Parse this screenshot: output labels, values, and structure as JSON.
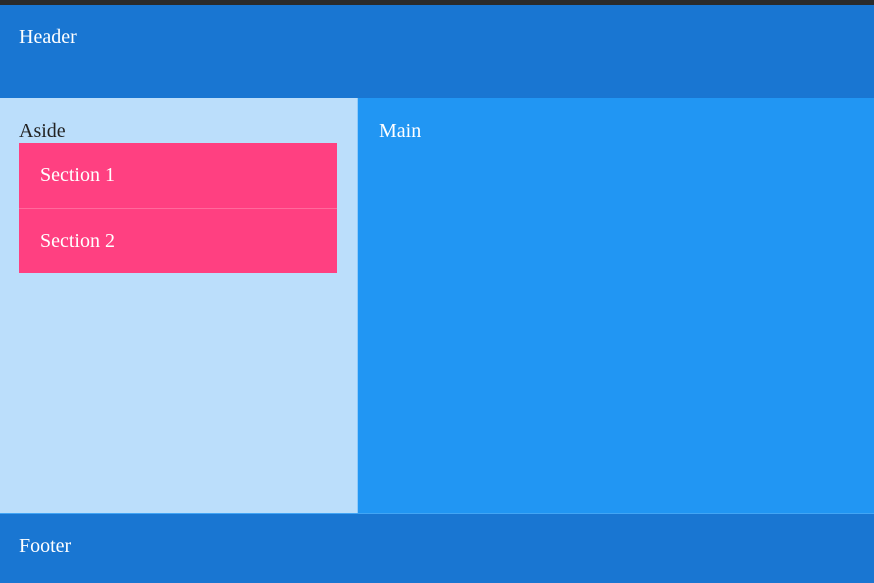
{
  "header": {
    "title": "Header"
  },
  "aside": {
    "title": "Aside",
    "sections": [
      {
        "label": "Section 1"
      },
      {
        "label": "Section 2"
      }
    ]
  },
  "main": {
    "title": "Main"
  },
  "footer": {
    "title": "Footer"
  },
  "colors": {
    "header_bg": "#1976d2",
    "aside_bg": "#bbdefb",
    "section_bg": "#ff4081",
    "main_bg": "#2196f3",
    "footer_bg": "#1976d2"
  }
}
